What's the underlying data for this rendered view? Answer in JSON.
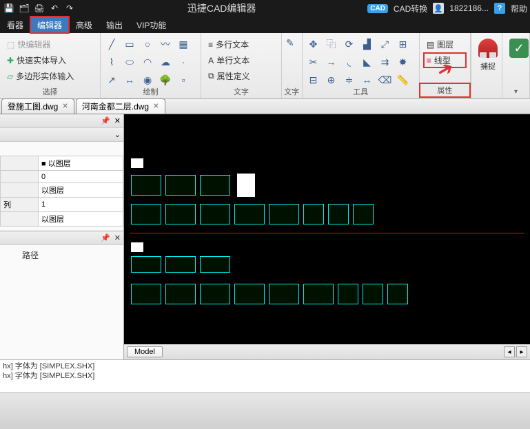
{
  "titlebar": {
    "app_title": "迅捷CAD编辑器",
    "cad_convert": "CAD转换",
    "user": "1822186...",
    "help": "帮助"
  },
  "menubar": {
    "tabs": [
      "看器",
      "编辑器",
      "高级",
      "输出",
      "VIP功能"
    ],
    "active_index": 1
  },
  "ribbon": {
    "select": {
      "quick_edit": "快编辑器",
      "fast_import": "快速实体导入",
      "polygon_input": "多边形实体输入",
      "label": "选择"
    },
    "draw": {
      "label": "绘制"
    },
    "text": {
      "multi": "多行文本",
      "single": "单行文本",
      "attrdef": "属性定义",
      "textmod": "文字",
      "label": "文字"
    },
    "tools": {
      "label": "工具"
    },
    "attrs": {
      "layer": "图层",
      "linetype": "线型",
      "label": "属性"
    },
    "snap": {
      "label": "捕捉"
    }
  },
  "tabs": {
    "files": [
      {
        "name": "登施工图.dwg"
      },
      {
        "name": "河南金都二层.dwg"
      }
    ]
  },
  "props": {
    "rows": [
      [
        "",
        "■ 以图层"
      ],
      [
        "",
        "0"
      ],
      [
        "",
        "以图层"
      ],
      [
        "列",
        "1"
      ],
      [
        "",
        "以图层"
      ]
    ],
    "path_label": "路径"
  },
  "canvas": {
    "model_tab": "Model"
  },
  "cmd": {
    "lines": [
      "hx] 字体为 [SIMPLEX.SHX]",
      "hx] 字体为 [SIMPLEX.SHX]"
    ]
  }
}
